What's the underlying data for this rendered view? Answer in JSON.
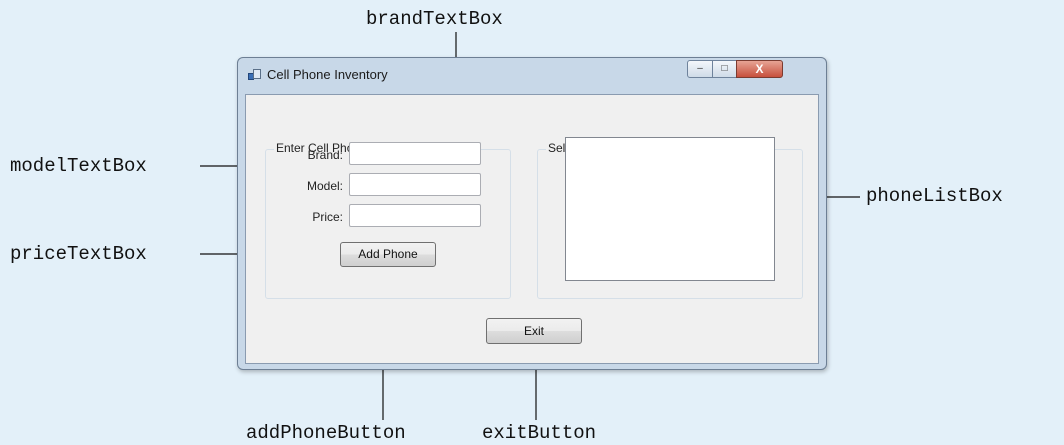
{
  "window": {
    "title": "Cell Phone Inventory",
    "minimize_glyph": "–",
    "maximize_glyph": "□",
    "close_glyph": "X"
  },
  "data_group": {
    "title": "Enter Cell Phone Data",
    "brand_label": "Brand:",
    "model_label": "Model:",
    "price_label": "Price:",
    "brand_value": "",
    "model_value": "",
    "price_value": "",
    "add_button": "Add Phone"
  },
  "select_group": {
    "title": "Select a Phone",
    "items": []
  },
  "exit_button": "Exit",
  "callouts": {
    "brand": "brandTextBox",
    "model": "modelTextBox",
    "price": "priceTextBox",
    "list": "phoneListBox",
    "add": "addPhoneButton",
    "exit": "exitButton"
  }
}
